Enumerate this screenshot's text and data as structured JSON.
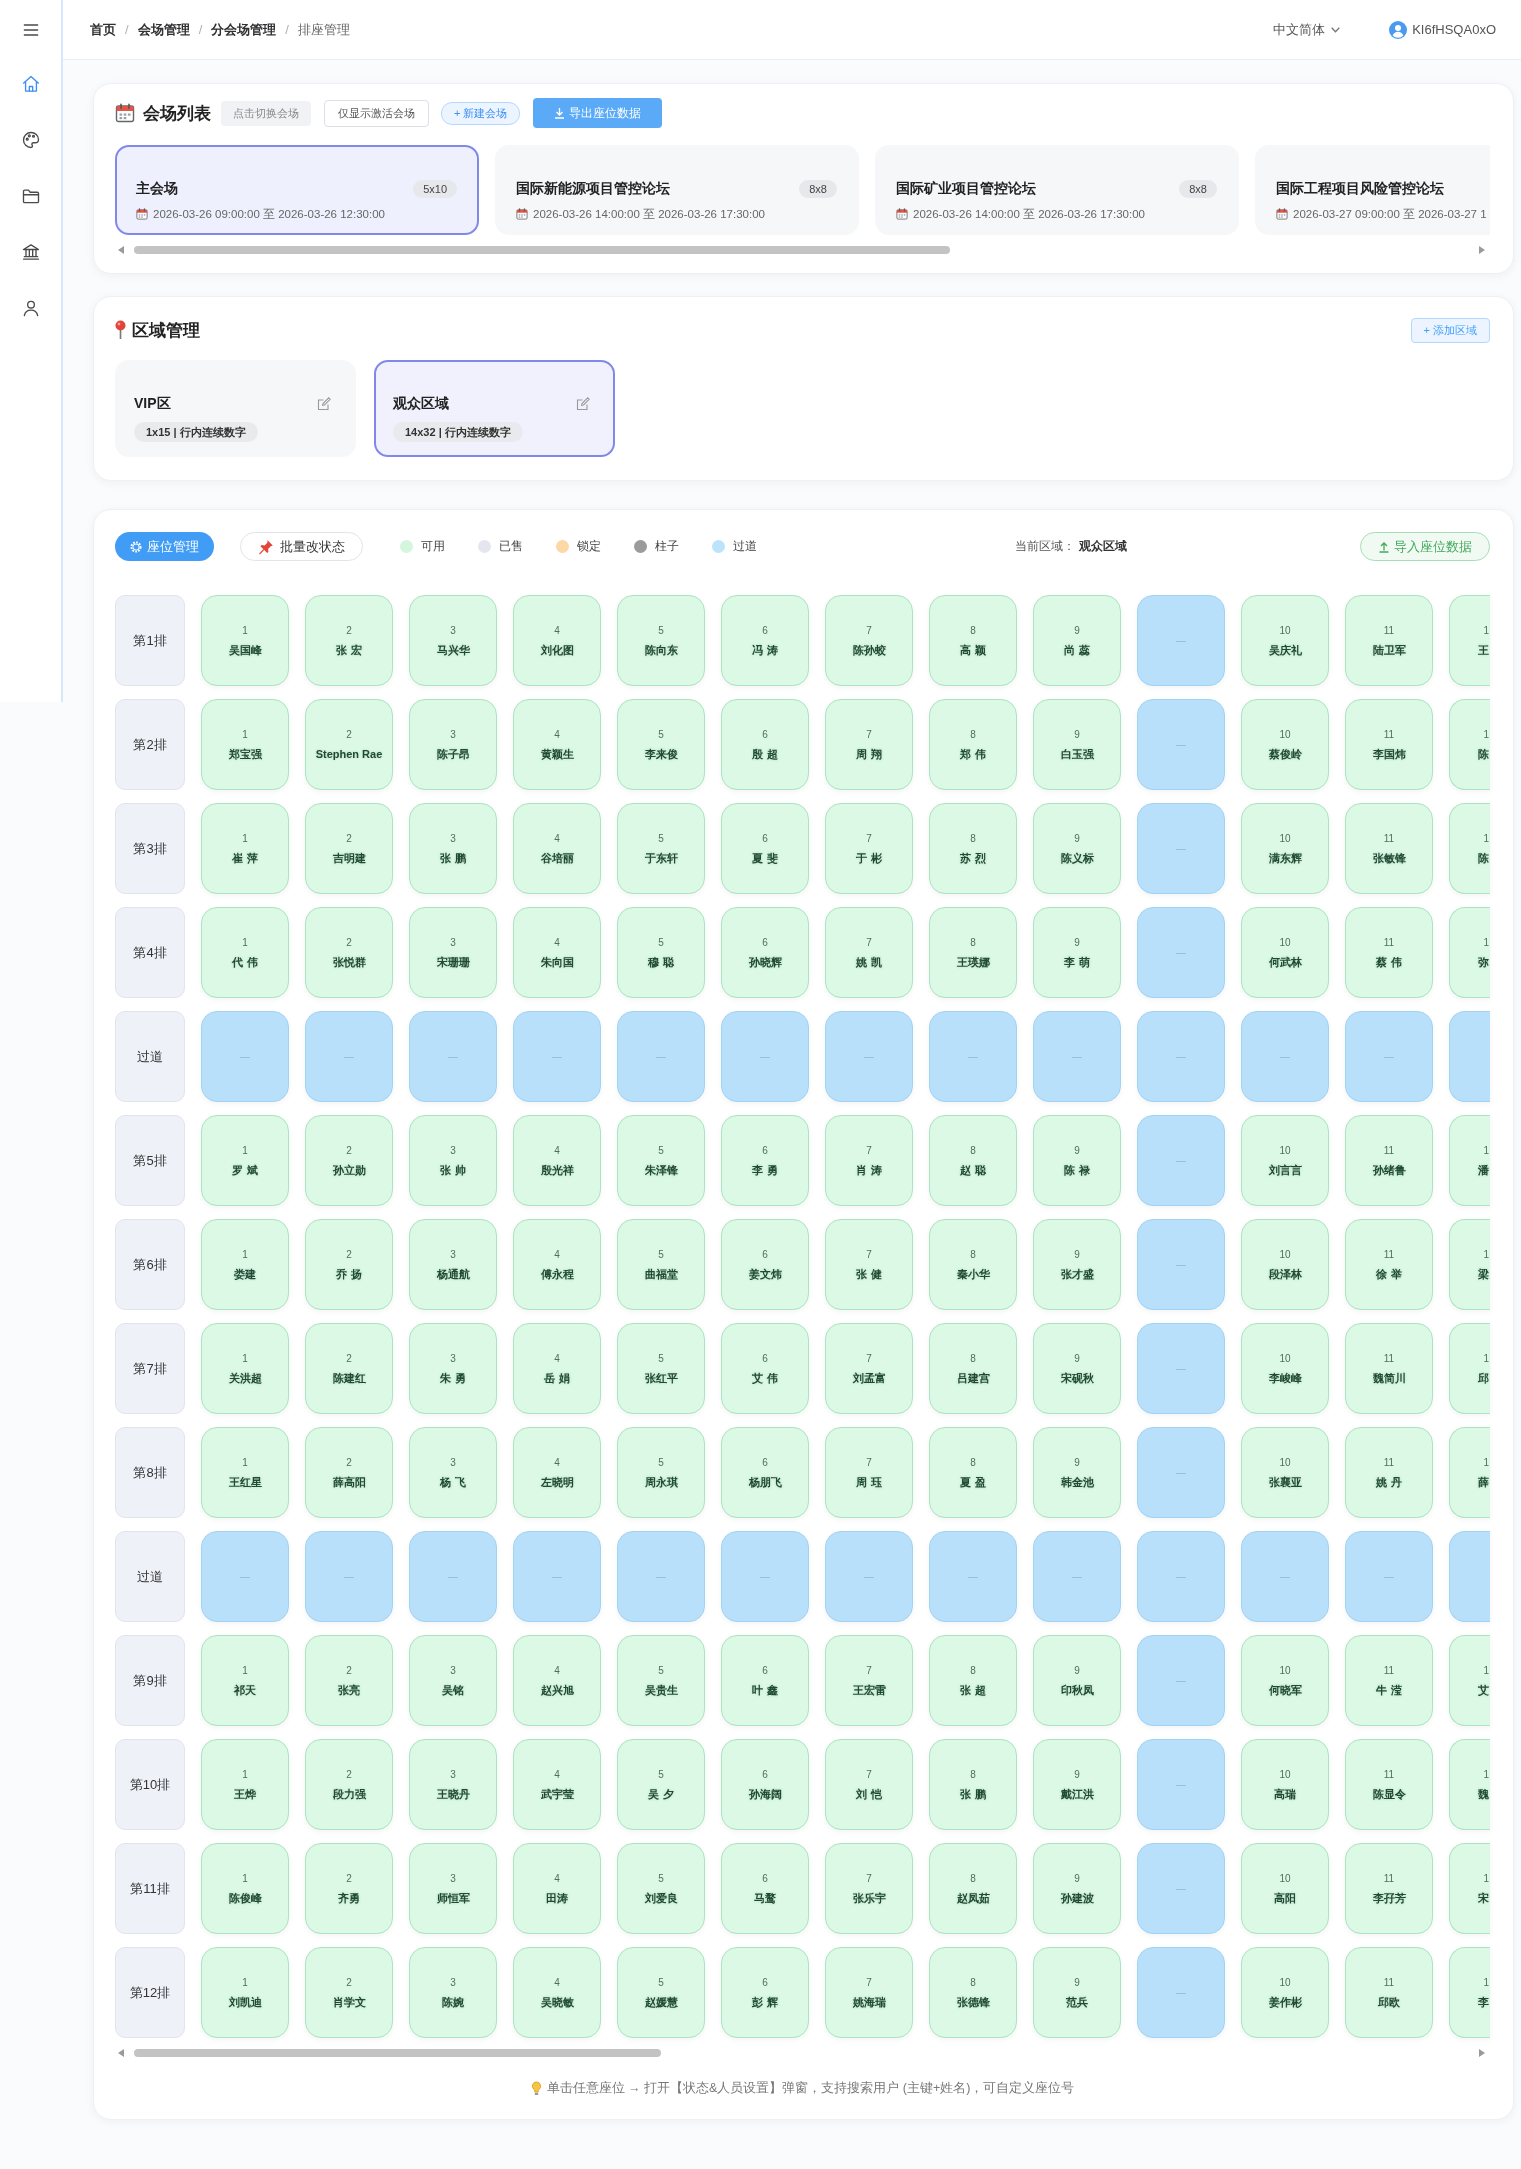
{
  "sidebar": {
    "items": [
      {
        "selected": true
      },
      {
        "selected": false
      },
      {
        "selected": false
      },
      {
        "selected": false
      },
      {
        "selected": false
      }
    ]
  },
  "topbar": {
    "breadcrumb": {
      "items": [
        {
          "label": "首页",
          "current": false
        },
        {
          "separator": "/",
          "label": "会场管理",
          "current": false
        },
        {
          "separator": "/",
          "label": "分会场管理",
          "current": false
        },
        {
          "separator": "/",
          "label": "排座管理",
          "current": true
        }
      ]
    },
    "language": "中文简体",
    "user": "KI6fHSQA0xO"
  },
  "venues": {
    "title": "会场列表",
    "hint": "点击切换会场",
    "filter_button": "仅显示激活会场",
    "new_button": "+ 新建会场",
    "export_button": "导出座位数据",
    "cards": [
      {
        "name": "主会场",
        "size": "5x10",
        "time": "2026-03-26 09:00:00 至 2026-03-26 12:30:00",
        "selected": true
      },
      {
        "name": "国际新能源项目管控论坛",
        "size": "8x8",
        "time": "2026-03-26 14:00:00 至 2026-03-26 17:30:00",
        "selected": false
      },
      {
        "name": "国际矿业项目管控论坛",
        "size": "8x8",
        "time": "2026-03-26 14:00:00 至 2026-03-26 17:30:00",
        "selected": false
      },
      {
        "name": "国际工程项目风险管控论坛",
        "time": "2026-03-27 09:00:00 至 2026-03-27 1",
        "selected": false
      }
    ]
  },
  "zones": {
    "title": "区域管理",
    "add_button": "+ 添加区域",
    "cards": [
      {
        "name": "VIP区",
        "info": "1x15 | 行内连续数字",
        "selected": false
      },
      {
        "name": "观众区域",
        "info": "14x32 | 行内连续数字",
        "selected": true
      }
    ]
  },
  "seating": {
    "mode_button": "座位管理",
    "batch_button": "批量改状态",
    "legend": [
      {
        "label": "可用",
        "color": "#d4f5de"
      },
      {
        "label": "已售",
        "color": "#e5e5ef"
      },
      {
        "label": "锁定",
        "color": "#fdd8a6"
      },
      {
        "label": "柱子",
        "color": "#9b9b9b"
      },
      {
        "label": "过道",
        "color": "#bde3fb"
      }
    ],
    "current_area_label": "当前区域：",
    "current_area": "观众区域",
    "import_button": "导入座位数据",
    "rows": [
      {
        "label": "第1排",
        "seats": [
          {
            "kind": "seat",
            "number": "1",
            "name": "吴国峰"
          },
          {
            "kind": "seat",
            "number": "2",
            "name": "张 宏"
          },
          {
            "kind": "seat",
            "number": "3",
            "name": "马兴华"
          },
          {
            "kind": "seat",
            "number": "4",
            "name": "刘化图"
          },
          {
            "kind": "seat",
            "number": "5",
            "name": "陈向东"
          },
          {
            "kind": "seat",
            "number": "6",
            "name": "冯 涛"
          },
          {
            "kind": "seat",
            "number": "7",
            "name": "陈孙蛟"
          },
          {
            "kind": "seat",
            "number": "8",
            "name": "高 颖"
          },
          {
            "kind": "seat",
            "number": "9",
            "name": "尚 蕊"
          },
          {
            "kind": "aisle",
            "mark": "—"
          },
          {
            "kind": "seat",
            "number": "10",
            "name": "吴庆礼"
          },
          {
            "kind": "seat",
            "number": "11",
            "name": "陆卫军"
          },
          {
            "kind": "seat",
            "number": "1",
            "name": "王"
          }
        ]
      },
      {
        "label": "第2排",
        "seats": [
          {
            "kind": "seat",
            "number": "1",
            "name": "郑宝强"
          },
          {
            "kind": "seat",
            "number": "2",
            "name": "Stephen Rae"
          },
          {
            "kind": "seat",
            "number": "3",
            "name": "陈子昂"
          },
          {
            "kind": "seat",
            "number": "4",
            "name": "黄颖生"
          },
          {
            "kind": "seat",
            "number": "5",
            "name": "李来俊"
          },
          {
            "kind": "seat",
            "number": "6",
            "name": "殷 超"
          },
          {
            "kind": "seat",
            "number": "7",
            "name": "周 翔"
          },
          {
            "kind": "seat",
            "number": "8",
            "name": "郑 伟"
          },
          {
            "kind": "seat",
            "number": "9",
            "name": "白玉强"
          },
          {
            "kind": "aisle",
            "mark": "—"
          },
          {
            "kind": "seat",
            "number": "10",
            "name": "蔡俊岭"
          },
          {
            "kind": "seat",
            "number": "11",
            "name": "李国炜"
          },
          {
            "kind": "seat",
            "number": "1",
            "name": "陈"
          }
        ]
      },
      {
        "label": "第3排",
        "seats": [
          {
            "kind": "seat",
            "number": "1",
            "name": "崔 萍"
          },
          {
            "kind": "seat",
            "number": "2",
            "name": "吉明建"
          },
          {
            "kind": "seat",
            "number": "3",
            "name": "张 鹏"
          },
          {
            "kind": "seat",
            "number": "4",
            "name": "谷培丽"
          },
          {
            "kind": "seat",
            "number": "5",
            "name": "于东轩"
          },
          {
            "kind": "seat",
            "number": "6",
            "name": "夏 斐"
          },
          {
            "kind": "seat",
            "number": "7",
            "name": "于 彬"
          },
          {
            "kind": "seat",
            "number": "8",
            "name": "苏 烈"
          },
          {
            "kind": "seat",
            "number": "9",
            "name": "陈义标"
          },
          {
            "kind": "aisle",
            "mark": "—"
          },
          {
            "kind": "seat",
            "number": "10",
            "name": "满东辉"
          },
          {
            "kind": "seat",
            "number": "11",
            "name": "张敏锋"
          },
          {
            "kind": "seat",
            "number": "1",
            "name": "陈"
          }
        ]
      },
      {
        "label": "第4排",
        "seats": [
          {
            "kind": "seat",
            "number": "1",
            "name": "代 伟"
          },
          {
            "kind": "seat",
            "number": "2",
            "name": "张悦群"
          },
          {
            "kind": "seat",
            "number": "3",
            "name": "宋珊珊"
          },
          {
            "kind": "seat",
            "number": "4",
            "name": "朱向国"
          },
          {
            "kind": "seat",
            "number": "5",
            "name": "穆 聪"
          },
          {
            "kind": "seat",
            "number": "6",
            "name": "孙晓辉"
          },
          {
            "kind": "seat",
            "number": "7",
            "name": "姚 凯"
          },
          {
            "kind": "seat",
            "number": "8",
            "name": "王瑛娜"
          },
          {
            "kind": "seat",
            "number": "9",
            "name": "李 萌"
          },
          {
            "kind": "aisle",
            "mark": "—"
          },
          {
            "kind": "seat",
            "number": "10",
            "name": "何武林"
          },
          {
            "kind": "seat",
            "number": "11",
            "name": "蔡 伟"
          },
          {
            "kind": "seat",
            "number": "1",
            "name": "弥"
          }
        ]
      },
      {
        "label": "过道",
        "seats": [
          {
            "kind": "aisle",
            "mark": "—"
          },
          {
            "kind": "aisle",
            "mark": "—"
          },
          {
            "kind": "aisle",
            "mark": "—"
          },
          {
            "kind": "aisle",
            "mark": "—"
          },
          {
            "kind": "aisle",
            "mark": "—"
          },
          {
            "kind": "aisle",
            "mark": "—"
          },
          {
            "kind": "aisle",
            "mark": "—"
          },
          {
            "kind": "aisle",
            "mark": "—"
          },
          {
            "kind": "aisle",
            "mark": "—"
          },
          {
            "kind": "aisle",
            "mark": "—"
          },
          {
            "kind": "aisle",
            "mark": "—"
          },
          {
            "kind": "aisle",
            "mark": "—"
          },
          {
            "kind": "aisle"
          }
        ]
      },
      {
        "label": "第5排",
        "seats": [
          {
            "kind": "seat",
            "number": "1",
            "name": "罗 斌"
          },
          {
            "kind": "seat",
            "number": "2",
            "name": "孙立勋"
          },
          {
            "kind": "seat",
            "number": "3",
            "name": "张 帅"
          },
          {
            "kind": "seat",
            "number": "4",
            "name": "殷光祥"
          },
          {
            "kind": "seat",
            "number": "5",
            "name": "朱泽锋"
          },
          {
            "kind": "seat",
            "number": "6",
            "name": "李 勇"
          },
          {
            "kind": "seat",
            "number": "7",
            "name": "肖 涛"
          },
          {
            "kind": "seat",
            "number": "8",
            "name": "赵 聪"
          },
          {
            "kind": "seat",
            "number": "9",
            "name": "陈 禄"
          },
          {
            "kind": "aisle",
            "mark": "—"
          },
          {
            "kind": "seat",
            "number": "10",
            "name": "刘言言"
          },
          {
            "kind": "seat",
            "number": "11",
            "name": "孙绪鲁"
          },
          {
            "kind": "seat",
            "number": "1",
            "name": "潘"
          }
        ]
      },
      {
        "label": "第6排",
        "seats": [
          {
            "kind": "seat",
            "number": "1",
            "name": "娄建"
          },
          {
            "kind": "seat",
            "number": "2",
            "name": "乔 扬"
          },
          {
            "kind": "seat",
            "number": "3",
            "name": "杨通航"
          },
          {
            "kind": "seat",
            "number": "4",
            "name": "傅永程"
          },
          {
            "kind": "seat",
            "number": "5",
            "name": "曲福堂"
          },
          {
            "kind": "seat",
            "number": "6",
            "name": "姜文炜"
          },
          {
            "kind": "seat",
            "number": "7",
            "name": "张 健"
          },
          {
            "kind": "seat",
            "number": "8",
            "name": "秦小华"
          },
          {
            "kind": "seat",
            "number": "9",
            "name": "张才盛"
          },
          {
            "kind": "aisle",
            "mark": "—"
          },
          {
            "kind": "seat",
            "number": "10",
            "name": "段泽林"
          },
          {
            "kind": "seat",
            "number": "11",
            "name": "徐 举"
          },
          {
            "kind": "seat",
            "number": "1",
            "name": "梁"
          }
        ]
      },
      {
        "label": "第7排",
        "seats": [
          {
            "kind": "seat",
            "number": "1",
            "name": "关洪超"
          },
          {
            "kind": "seat",
            "number": "2",
            "name": "陈建红"
          },
          {
            "kind": "seat",
            "number": "3",
            "name": "朱 勇"
          },
          {
            "kind": "seat",
            "number": "4",
            "name": "岳 娟"
          },
          {
            "kind": "seat",
            "number": "5",
            "name": "张红平"
          },
          {
            "kind": "seat",
            "number": "6",
            "name": "艾 伟"
          },
          {
            "kind": "seat",
            "number": "7",
            "name": "刘孟富"
          },
          {
            "kind": "seat",
            "number": "8",
            "name": "吕建宫"
          },
          {
            "kind": "seat",
            "number": "9",
            "name": "宋砚秋"
          },
          {
            "kind": "aisle",
            "mark": "—"
          },
          {
            "kind": "seat",
            "number": "10",
            "name": "李峻峰"
          },
          {
            "kind": "seat",
            "number": "11",
            "name": "魏简川"
          },
          {
            "kind": "seat",
            "number": "1",
            "name": "邱"
          }
        ]
      },
      {
        "label": "第8排",
        "seats": [
          {
            "kind": "seat",
            "number": "1",
            "name": "王红星"
          },
          {
            "kind": "seat",
            "number": "2",
            "name": "薛高阳"
          },
          {
            "kind": "seat",
            "number": "3",
            "name": "杨 飞"
          },
          {
            "kind": "seat",
            "number": "4",
            "name": "左晓明"
          },
          {
            "kind": "seat",
            "number": "5",
            "name": "周永琪"
          },
          {
            "kind": "seat",
            "number": "6",
            "name": "杨朋飞"
          },
          {
            "kind": "seat",
            "number": "7",
            "name": "周 珏"
          },
          {
            "kind": "seat",
            "number": "8",
            "name": "夏 盈"
          },
          {
            "kind": "seat",
            "number": "9",
            "name": "韩金池"
          },
          {
            "kind": "aisle",
            "mark": "—"
          },
          {
            "kind": "seat",
            "number": "10",
            "name": "张襄亚"
          },
          {
            "kind": "seat",
            "number": "11",
            "name": "姚 丹"
          },
          {
            "kind": "seat",
            "number": "1",
            "name": "薛"
          }
        ]
      },
      {
        "label": "过道",
        "seats": [
          {
            "kind": "aisle",
            "mark": "—"
          },
          {
            "kind": "aisle",
            "mark": "—"
          },
          {
            "kind": "aisle",
            "mark": "—"
          },
          {
            "kind": "aisle",
            "mark": "—"
          },
          {
            "kind": "aisle",
            "mark": "—"
          },
          {
            "kind": "aisle",
            "mark": "—"
          },
          {
            "kind": "aisle",
            "mark": "—"
          },
          {
            "kind": "aisle",
            "mark": "—"
          },
          {
            "kind": "aisle",
            "mark": "—"
          },
          {
            "kind": "aisle",
            "mark": "—"
          },
          {
            "kind": "aisle",
            "mark": "—"
          },
          {
            "kind": "aisle",
            "mark": "—"
          },
          {
            "kind": "aisle"
          }
        ]
      },
      {
        "label": "第9排",
        "seats": [
          {
            "kind": "seat",
            "number": "1",
            "name": "祁天"
          },
          {
            "kind": "seat",
            "number": "2",
            "name": "张亮"
          },
          {
            "kind": "seat",
            "number": "3",
            "name": "吴铭"
          },
          {
            "kind": "seat",
            "number": "4",
            "name": "赵兴旭"
          },
          {
            "kind": "seat",
            "number": "5",
            "name": "吴贵生"
          },
          {
            "kind": "seat",
            "number": "6",
            "name": "叶 鑫"
          },
          {
            "kind": "seat",
            "number": "7",
            "name": "王宏雷"
          },
          {
            "kind": "seat",
            "number": "8",
            "name": "张 超"
          },
          {
            "kind": "seat",
            "number": "9",
            "name": "印秋凤"
          },
          {
            "kind": "aisle",
            "mark": "—"
          },
          {
            "kind": "seat",
            "number": "10",
            "name": "何晓军"
          },
          {
            "kind": "seat",
            "number": "11",
            "name": "牛 滢"
          },
          {
            "kind": "seat",
            "number": "1",
            "name": "艾"
          }
        ]
      },
      {
        "label": "第10排",
        "seats": [
          {
            "kind": "seat",
            "number": "1",
            "name": "王烨"
          },
          {
            "kind": "seat",
            "number": "2",
            "name": "段力强"
          },
          {
            "kind": "seat",
            "number": "3",
            "name": "王晓丹"
          },
          {
            "kind": "seat",
            "number": "4",
            "name": "武宇莹"
          },
          {
            "kind": "seat",
            "number": "5",
            "name": "吴 夕"
          },
          {
            "kind": "seat",
            "number": "6",
            "name": "孙海阔"
          },
          {
            "kind": "seat",
            "number": "7",
            "name": "刘 恺"
          },
          {
            "kind": "seat",
            "number": "8",
            "name": "张 鹏"
          },
          {
            "kind": "seat",
            "number": "9",
            "name": "戴江洪"
          },
          {
            "kind": "aisle",
            "mark": "—"
          },
          {
            "kind": "seat",
            "number": "10",
            "name": "高瑞"
          },
          {
            "kind": "seat",
            "number": "11",
            "name": "陈显令"
          },
          {
            "kind": "seat",
            "number": "1",
            "name": "魏"
          }
        ]
      },
      {
        "label": "第11排",
        "seats": [
          {
            "kind": "seat",
            "number": "1",
            "name": "陈俊峰"
          },
          {
            "kind": "seat",
            "number": "2",
            "name": "齐勇"
          },
          {
            "kind": "seat",
            "number": "3",
            "name": "师恒军"
          },
          {
            "kind": "seat",
            "number": "4",
            "name": "田涛"
          },
          {
            "kind": "seat",
            "number": "5",
            "name": "刘爱良"
          },
          {
            "kind": "seat",
            "number": "6",
            "name": "马鹜"
          },
          {
            "kind": "seat",
            "number": "7",
            "name": "张乐宇"
          },
          {
            "kind": "seat",
            "number": "8",
            "name": "赵凤茹"
          },
          {
            "kind": "seat",
            "number": "9",
            "name": "孙建波"
          },
          {
            "kind": "aisle",
            "mark": "—"
          },
          {
            "kind": "seat",
            "number": "10",
            "name": "高阳"
          },
          {
            "kind": "seat",
            "number": "11",
            "name": "李孖芳"
          },
          {
            "kind": "seat",
            "number": "1",
            "name": "宋"
          }
        ]
      },
      {
        "label": "第12排",
        "seats": [
          {
            "kind": "seat",
            "number": "1",
            "name": "刘凯迪"
          },
          {
            "kind": "seat",
            "number": "2",
            "name": "肖学文"
          },
          {
            "kind": "seat",
            "number": "3",
            "name": "陈婉"
          },
          {
            "kind": "seat",
            "number": "4",
            "name": "吴晓敏"
          },
          {
            "kind": "seat",
            "number": "5",
            "name": "赵媛慧"
          },
          {
            "kind": "seat",
            "number": "6",
            "name": "彭 辉"
          },
          {
            "kind": "seat",
            "number": "7",
            "name": "姚海瑞"
          },
          {
            "kind": "seat",
            "number": "8",
            "name": "张德锋"
          },
          {
            "kind": "seat",
            "number": "9",
            "name": "范兵"
          },
          {
            "kind": "aisle",
            "mark": "—"
          },
          {
            "kind": "seat",
            "number": "10",
            "name": "姜作彬"
          },
          {
            "kind": "seat",
            "number": "11",
            "name": "邱欧"
          },
          {
            "kind": "seat",
            "number": "1",
            "name": "李"
          }
        ]
      }
    ],
    "hint": "单击任意座位 → 打开【状态&人员设置】弹窗，支持搜索用户 (主键+姓名)，可自定义座位号"
  }
}
